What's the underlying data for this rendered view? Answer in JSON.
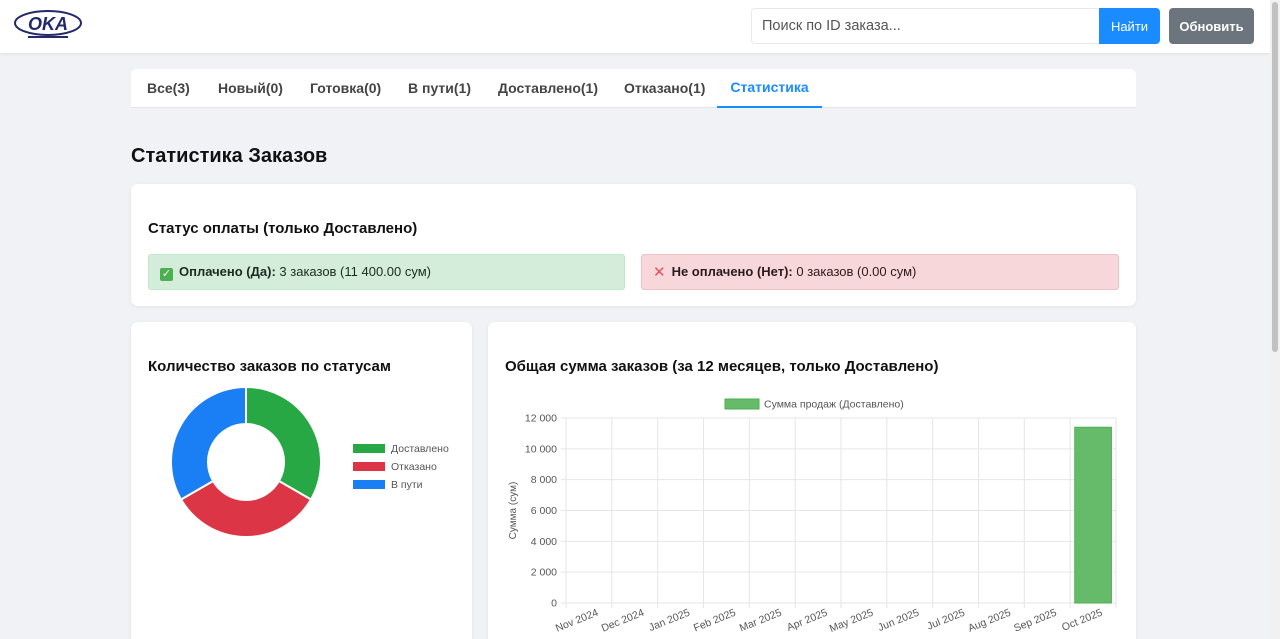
{
  "header": {
    "logo_text": "OKA",
    "search_placeholder": "Поиск по ID заказа...",
    "find_label": "Найти",
    "refresh_label": "Обновить"
  },
  "tabs": [
    {
      "label": "Все(3)",
      "active": false
    },
    {
      "label": "Новый(0)",
      "active": false
    },
    {
      "label": "Готовка(0)",
      "active": false
    },
    {
      "label": "В пути(1)",
      "active": false
    },
    {
      "label": "Доставлено(1)",
      "active": false
    },
    {
      "label": "Отказано(1)",
      "active": false
    },
    {
      "label": "Статистика",
      "active": true
    }
  ],
  "page_title": "Статистика Заказов",
  "payment": {
    "title": "Статус оплаты (только Доставлено)",
    "paid_label": "Оплачено (Да):",
    "paid_text": " 3 заказов (11 400.00 сум)",
    "unpaid_label": "Не оплачено (Нет):",
    "unpaid_text": " 0 заказов (0.00 сум)",
    "paid_icon": "check-box-icon",
    "unpaid_icon": "cross-icon"
  },
  "colors": {
    "accent": "#1a8cff",
    "green": "#28a745",
    "red": "#dc3545",
    "blue": "#1a7ff5",
    "bar": "#66bb6a"
  },
  "donut_card": {
    "title": "Количество заказов по статусам"
  },
  "bar_card": {
    "title": "Общая сумма заказов (за 12 месяцев, только Доставлено)"
  },
  "chart_data": [
    {
      "type": "pie",
      "title": "Количество заказов по статусам",
      "categories": [
        "Доставлено",
        "Отказано",
        "В пути"
      ],
      "values": [
        1,
        1,
        1
      ],
      "colors": [
        "#28a745",
        "#dc3545",
        "#1a7ff5"
      ],
      "legend": "right"
    },
    {
      "type": "bar",
      "title": "Общая сумма заказов (за 12 месяцев, только Доставлено)",
      "categories": [
        "Nov 2024",
        "Dec 2024",
        "Jan 2025",
        "Feb 2025",
        "Mar 2025",
        "Apr 2025",
        "May 2025",
        "Jun 2025",
        "Jul 2025",
        "Aug 2025",
        "Sep 2025",
        "Oct 2025"
      ],
      "series": [
        {
          "name": "Сумма продаж (Доставлено)",
          "values": [
            0,
            0,
            0,
            0,
            0,
            0,
            0,
            0,
            0,
            0,
            0,
            11400
          ]
        }
      ],
      "ylabel": "Сумма (сум)",
      "ylim": [
        0,
        12000
      ],
      "yticks": [
        "0",
        "2 000",
        "4 000",
        "6 000",
        "8 000",
        "10 000",
        "12 000"
      ],
      "grid": true,
      "legend": "top"
    }
  ]
}
